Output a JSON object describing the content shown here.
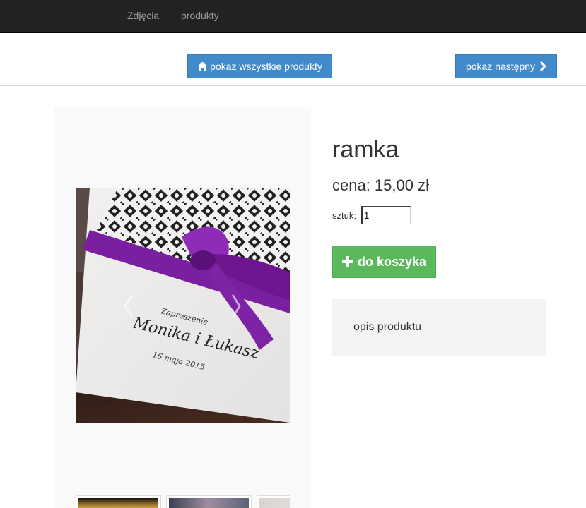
{
  "nav": {
    "items": [
      {
        "label": "Zdjęcia"
      },
      {
        "label": "produkty"
      }
    ]
  },
  "toolbar": {
    "show_all_label": "pokaż wszystkie produkty",
    "show_next_label": "pokaż następny"
  },
  "product": {
    "name": "ramka",
    "price_text": "cena: 15,00 zł",
    "quantity_label": "sztuk:",
    "quantity_value": "1",
    "add_to_cart_label": "do koszyka",
    "description": "opis produktu",
    "image": {
      "line1": "Zaproszenie",
      "line2": "Monika i Łukasz",
      "line3": "16 maja 2015"
    }
  },
  "colors": {
    "nav_bg": "#222222",
    "primary": "#428bca",
    "success": "#5cb85c",
    "ribbon": "#7a1fa0"
  },
  "icons": {
    "home": "home-icon",
    "next": "chevron-right-icon",
    "plus": "plus-icon"
  }
}
